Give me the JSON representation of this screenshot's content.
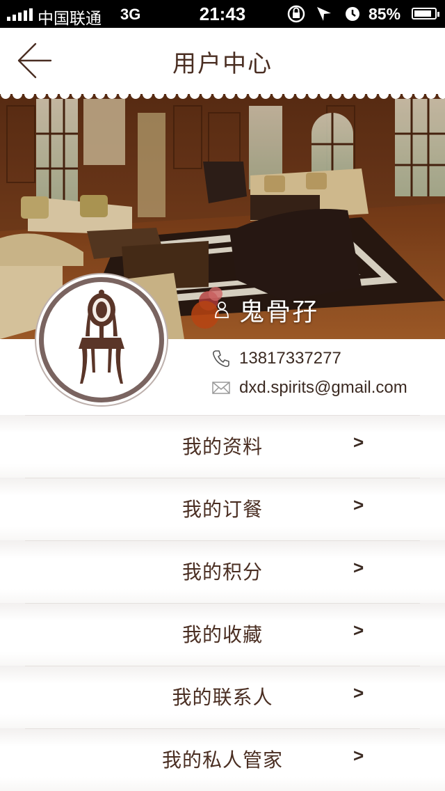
{
  "status_bar": {
    "carrier": "中国联通",
    "network": "3G",
    "time": "21:43",
    "battery": "85%",
    "battery_level": 0.85
  },
  "header": {
    "title": "用户中心"
  },
  "profile": {
    "username": "鬼骨孖",
    "phone": "13817337277",
    "email": "dxd.spirits@gmail.com"
  },
  "menu": {
    "items": [
      {
        "label": "我的资料",
        "chevron": ">"
      },
      {
        "label": "我的订餐",
        "chevron": ">"
      },
      {
        "label": "我的积分",
        "chevron": ">"
      },
      {
        "label": "我的收藏",
        "chevron": ">"
      },
      {
        "label": "我的联系人",
        "chevron": ">"
      },
      {
        "label": "我的私人管家",
        "chevron": ">"
      }
    ]
  },
  "colors": {
    "text_brown": "#4a2e22",
    "avatar_ring": "#7a6460"
  }
}
